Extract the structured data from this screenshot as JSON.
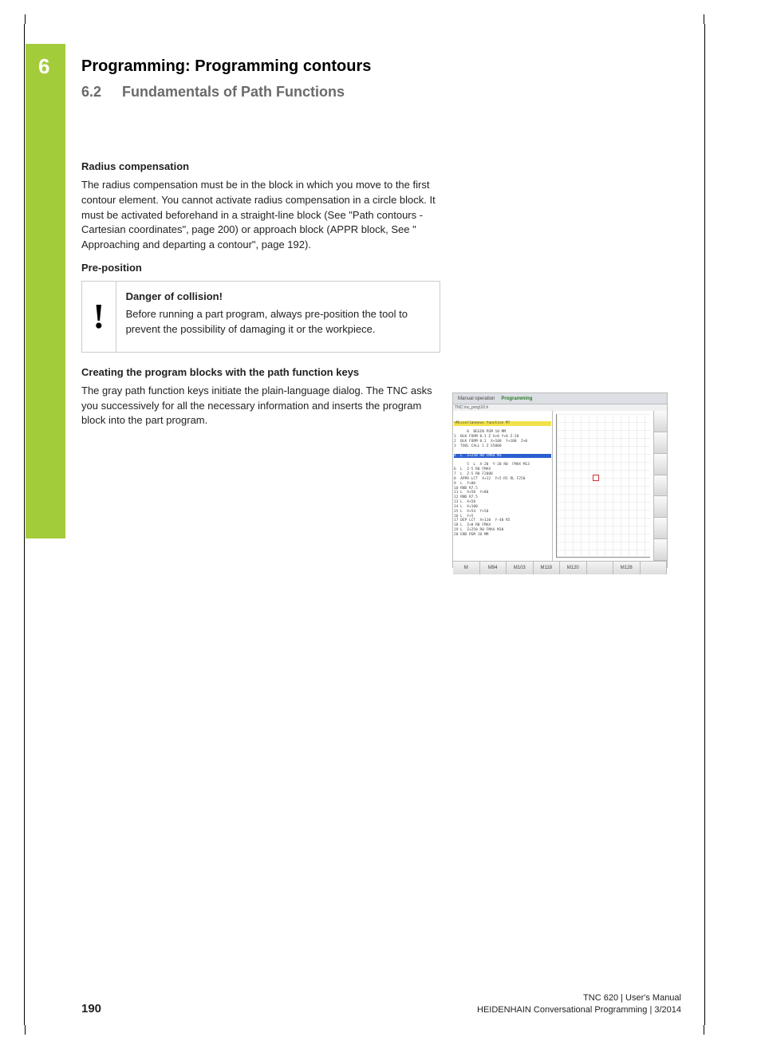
{
  "chapter": {
    "number": "6",
    "title": "Programming: Programming contours"
  },
  "section": {
    "number": "6.2",
    "title": "Fundamentals of Path Functions"
  },
  "s1": {
    "heading": "Radius compensation",
    "body": "The radius compensation must be in the block in which you move to the first contour element. You cannot activate radius compensation in a circle block. It must be activated beforehand in a straight-line block (See \"Path contours - Cartesian coordinates\", page 200) or approach block (APPR block, See \" Approaching and departing a contour\", page 192)."
  },
  "s2": {
    "heading": "Pre-position"
  },
  "warning": {
    "icon": "!",
    "title": "Danger of collision!",
    "body": "Before running a part program, always pre-position the tool to prevent the possibility of damaging it or the workpiece."
  },
  "s3": {
    "heading": "Creating the program blocks with the path function keys",
    "body": "The gray path function keys initiate the plain-language dialog. The TNC asks you successively for all the necessary information and inserts the program block into the part program."
  },
  "screenshot": {
    "tab1": "Manual operation",
    "tab2": "Programming",
    "subtitle": "TNC:\\nc_prog\\10.h",
    "hl_yellow1": "→Miscellaneous function M?",
    "code_lines": "0  BEGIN PGM 10 MM\n1  BLK FORM 0.1 Z X+0 Y+0 Z-20\n2  BLK FORM 0.2  X+100  Y+100  Z+0\n3  TOOL CALL 1 Z S5000",
    "hl_blue": "4  L  Z+250 R0 FMAX M3",
    "code_lines2": "5  L  X-20  Y-20 R0  FMAX M13\n6  L  Z-5 R0 FMAX\n7  L  Z-5 R0 F2000\n8  APPR LCT  X+12  Y+5 R5 RL F250\n9  L  Y+80\n10 RND R7.5\n11 L  X+50  Y+80\n12 RND R7.5\n13 L  X+50\n14 L  X+100\n15 L  X+54  Y+50\n16 L  Y+5\n17 DEP LCT  X+110  Y-40 R5\n18 L  Z+0 R0 FMAX\n19 L  Z+250 R0 FMAX M30\n20 END PGM 10 MM",
    "softkeys": [
      "M",
      "M94",
      "M103",
      "M118",
      "M120",
      "",
      "M128",
      ""
    ]
  },
  "footer": {
    "page": "190",
    "line1": "TNC 620 | User's Manual",
    "line2": "HEIDENHAIN Conversational Programming | 3/2014"
  }
}
